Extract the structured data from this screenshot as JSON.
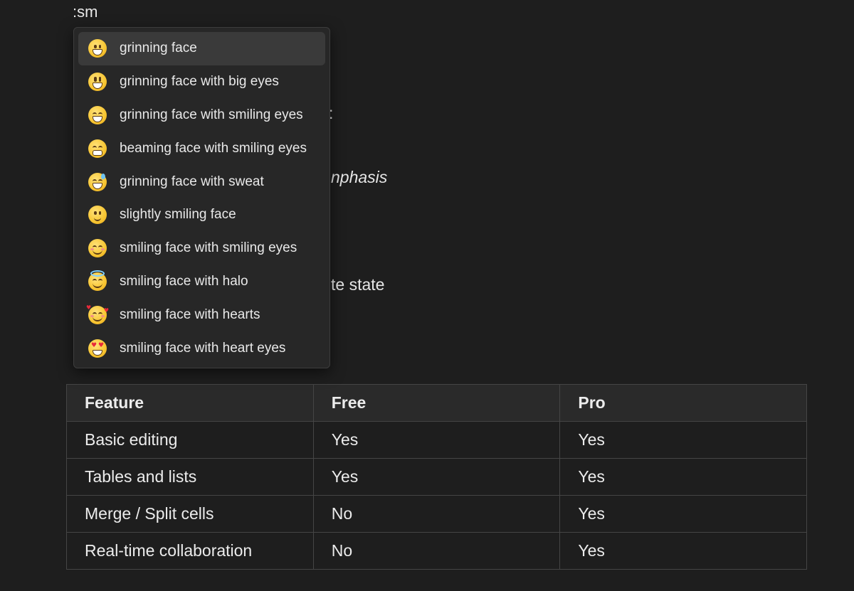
{
  "editor": {
    "trigger_text": ":sm",
    "background_fragments": {
      "colon": ":",
      "emphasis": "nphasis",
      "state": "te state"
    }
  },
  "emoji_menu": {
    "selected_index": 0,
    "items": [
      {
        "label": "grinning face",
        "icon": "grinning-face-icon"
      },
      {
        "label": "grinning face with big eyes",
        "icon": "grinning-face-big-eyes-icon"
      },
      {
        "label": "grinning face with smiling eyes",
        "icon": "grinning-face-smiling-eyes-icon"
      },
      {
        "label": "beaming face with smiling eyes",
        "icon": "beaming-face-icon"
      },
      {
        "label": "grinning face with sweat",
        "icon": "grinning-face-sweat-icon"
      },
      {
        "label": "slightly smiling face",
        "icon": "slightly-smiling-face-icon"
      },
      {
        "label": "smiling face with smiling eyes",
        "icon": "smiling-face-smiling-eyes-icon"
      },
      {
        "label": "smiling face with halo",
        "icon": "smiling-face-halo-icon"
      },
      {
        "label": "smiling face with hearts",
        "icon": "smiling-face-hearts-icon"
      },
      {
        "label": "smiling face with heart eyes",
        "icon": "smiling-face-heart-eyes-icon"
      }
    ]
  },
  "table": {
    "headers": [
      "Feature",
      "Free",
      "Pro"
    ],
    "rows": [
      [
        "Basic editing",
        "Yes",
        "Yes"
      ],
      [
        "Tables and lists",
        "Yes",
        "Yes"
      ],
      [
        "Merge / Split cells",
        "No",
        "Yes"
      ],
      [
        "Real-time collaboration",
        "No",
        "Yes"
      ]
    ]
  },
  "colors": {
    "background": "#1e1e1e",
    "menu_background": "#272727",
    "menu_selected": "#3a3a3a",
    "table_header": "#2a2a2a",
    "border": "#454545",
    "text": "#e6e6e6"
  }
}
